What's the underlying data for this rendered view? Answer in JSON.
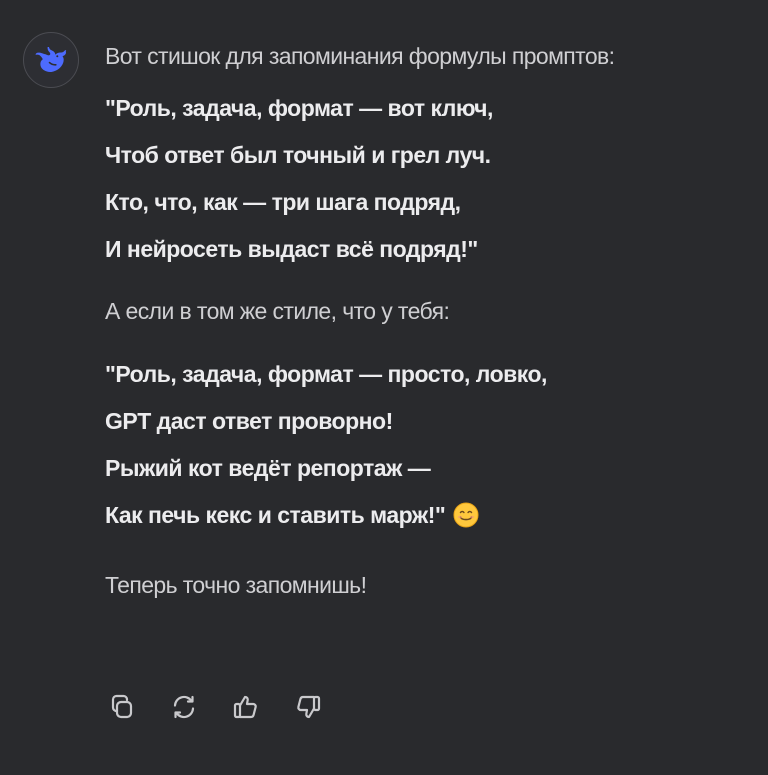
{
  "assistant": {
    "avatar_icon": "deepseek-whale-icon",
    "accent_color": "#4d6bfe"
  },
  "message": {
    "intro": "Вот стишок для запоминания формулы промптов:",
    "poem1": [
      "\"Роль, задача, формат — вот ключ,",
      "Чтоб ответ был точный и грел луч.",
      "Кто, что, как — три шага подряд,",
      "И нейросеть выдаст всё подряд!\""
    ],
    "middle": "А если в том же стиле, что у тебя:",
    "poem2": [
      "\"Роль, задача, формат — просто, ловко,",
      "GPT даст ответ проворно!",
      "Рыжий кот ведёт репортаж —",
      "Как печь кекс и ставить марж!\""
    ],
    "emoji": "smiling-face-emoji",
    "closing": "Теперь точно запомнишь!"
  },
  "actions": [
    {
      "name": "copy",
      "icon": "copy-icon"
    },
    {
      "name": "regenerate",
      "icon": "refresh-icon"
    },
    {
      "name": "like",
      "icon": "thumbs-up-icon"
    },
    {
      "name": "dislike",
      "icon": "thumbs-down-icon"
    }
  ]
}
